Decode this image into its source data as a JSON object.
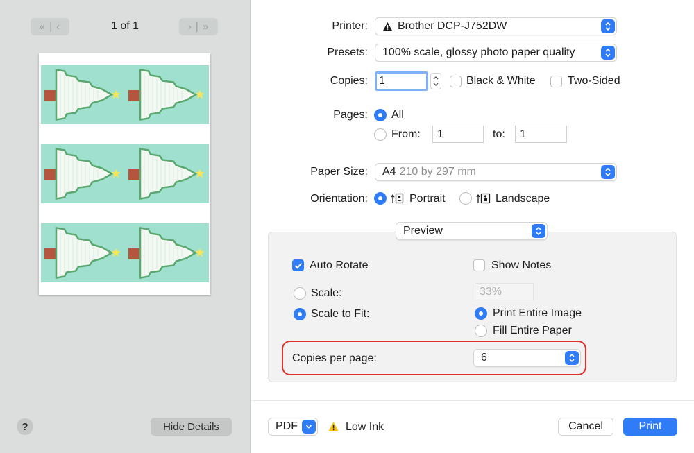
{
  "preview": {
    "page_indicator": "1 of 1",
    "first_page_icon": "double-chevron-left",
    "next_page_icon": "chevron-right-double",
    "help_label": "?",
    "hide_details_label": "Hide Details",
    "thumbnail_count": 6,
    "colors": {
      "mint": "#9fe0cf",
      "tree": "#f3f8f3",
      "tree_outline": "#5aa86f",
      "trunk": "#b5553f",
      "star": "#f7e65a"
    }
  },
  "printer": {
    "label": "Printer:",
    "value": "Brother DCP-J752DW",
    "icon": "warning-icon"
  },
  "presets": {
    "label": "Presets:",
    "value": "100% scale, glossy photo paper quality"
  },
  "copies": {
    "label": "Copies:",
    "value": "1",
    "black_white_label": "Black & White",
    "two_sided_label": "Two-Sided",
    "black_white_checked": false,
    "two_sided_checked": false
  },
  "pages": {
    "label": "Pages:",
    "all_label": "All",
    "from_label": "From:",
    "from_value": "1",
    "to_label": "to:",
    "to_value": "1",
    "selected": "All"
  },
  "paper_size": {
    "label": "Paper Size:",
    "value": "A4",
    "detail": "210 by 297 mm"
  },
  "orientation": {
    "label": "Orientation:",
    "portrait_label": "Portrait",
    "landscape_label": "Landscape",
    "selected": "Portrait"
  },
  "section_menu": {
    "value": "Preview"
  },
  "preview_options": {
    "auto_rotate_label": "Auto Rotate",
    "auto_rotate_checked": true,
    "show_notes_label": "Show Notes",
    "show_notes_checked": false,
    "scale_label": "Scale:",
    "scale_value": "33%",
    "scale_to_fit_label": "Scale to Fit:",
    "print_entire_image_label": "Print Entire Image",
    "fill_entire_paper_label": "Fill Entire Paper",
    "selected_scale": "Scale to Fit",
    "selected_fit": "Print Entire Image",
    "copies_per_page_label": "Copies per page:",
    "copies_per_page_value": "6"
  },
  "footer": {
    "pdf_label": "PDF",
    "low_ink_label": "Low Ink",
    "cancel_label": "Cancel",
    "print_label": "Print"
  },
  "colors": {
    "accent": "#2f7cf6",
    "highlight": "#e0302b",
    "warning": "#f5c518"
  }
}
